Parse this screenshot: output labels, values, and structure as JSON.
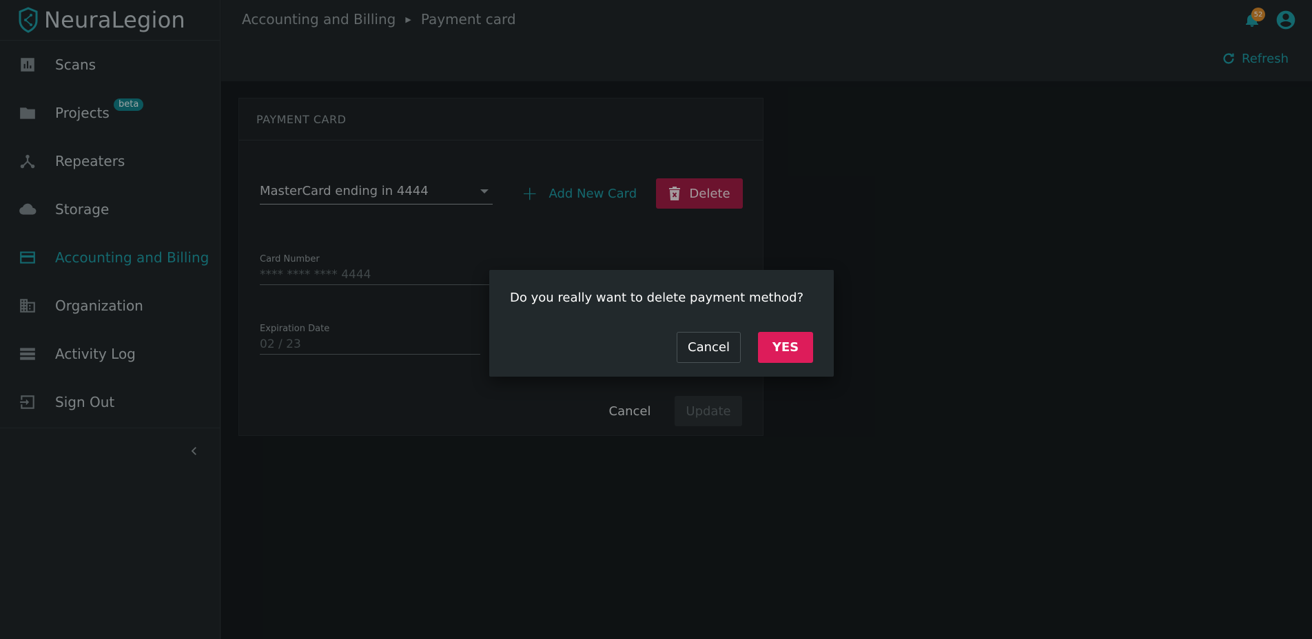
{
  "brand": {
    "name": "NeuraLegion",
    "accent": "#1e9aa3"
  },
  "sidebar": {
    "items": [
      {
        "label": "Scans",
        "icon": "bar-chart-icon"
      },
      {
        "label": "Projects",
        "icon": "folder-icon",
        "badge": "beta"
      },
      {
        "label": "Repeaters",
        "icon": "repeater-icon"
      },
      {
        "label": "Storage",
        "icon": "cloud-icon"
      },
      {
        "label": "Accounting and Billing",
        "icon": "credit-card-icon",
        "active": true
      },
      {
        "label": "Organization",
        "icon": "building-icon"
      },
      {
        "label": "Activity Log",
        "icon": "list-icon"
      },
      {
        "label": "Sign Out",
        "icon": "sign-out-icon"
      }
    ]
  },
  "header": {
    "breadcrumb": [
      "Accounting and Billing",
      "Payment card"
    ],
    "notification_count": "52",
    "refresh_label": "Refresh"
  },
  "card": {
    "title": "PAYMENT CARD",
    "selected_card": "MasterCard ending in 4444",
    "add_new_card_label": "Add New Card",
    "delete_label": "Delete",
    "card_number_label": "Card Number",
    "card_number_value": "**** **** **** 4444",
    "expiration_label": "Expiration Date",
    "expiration_value": "02 / 23",
    "cancel_label": "Cancel",
    "update_label": "Update"
  },
  "dialog": {
    "message": "Do you really want to delete payment method?",
    "cancel_label": "Cancel",
    "confirm_label": "YES"
  }
}
